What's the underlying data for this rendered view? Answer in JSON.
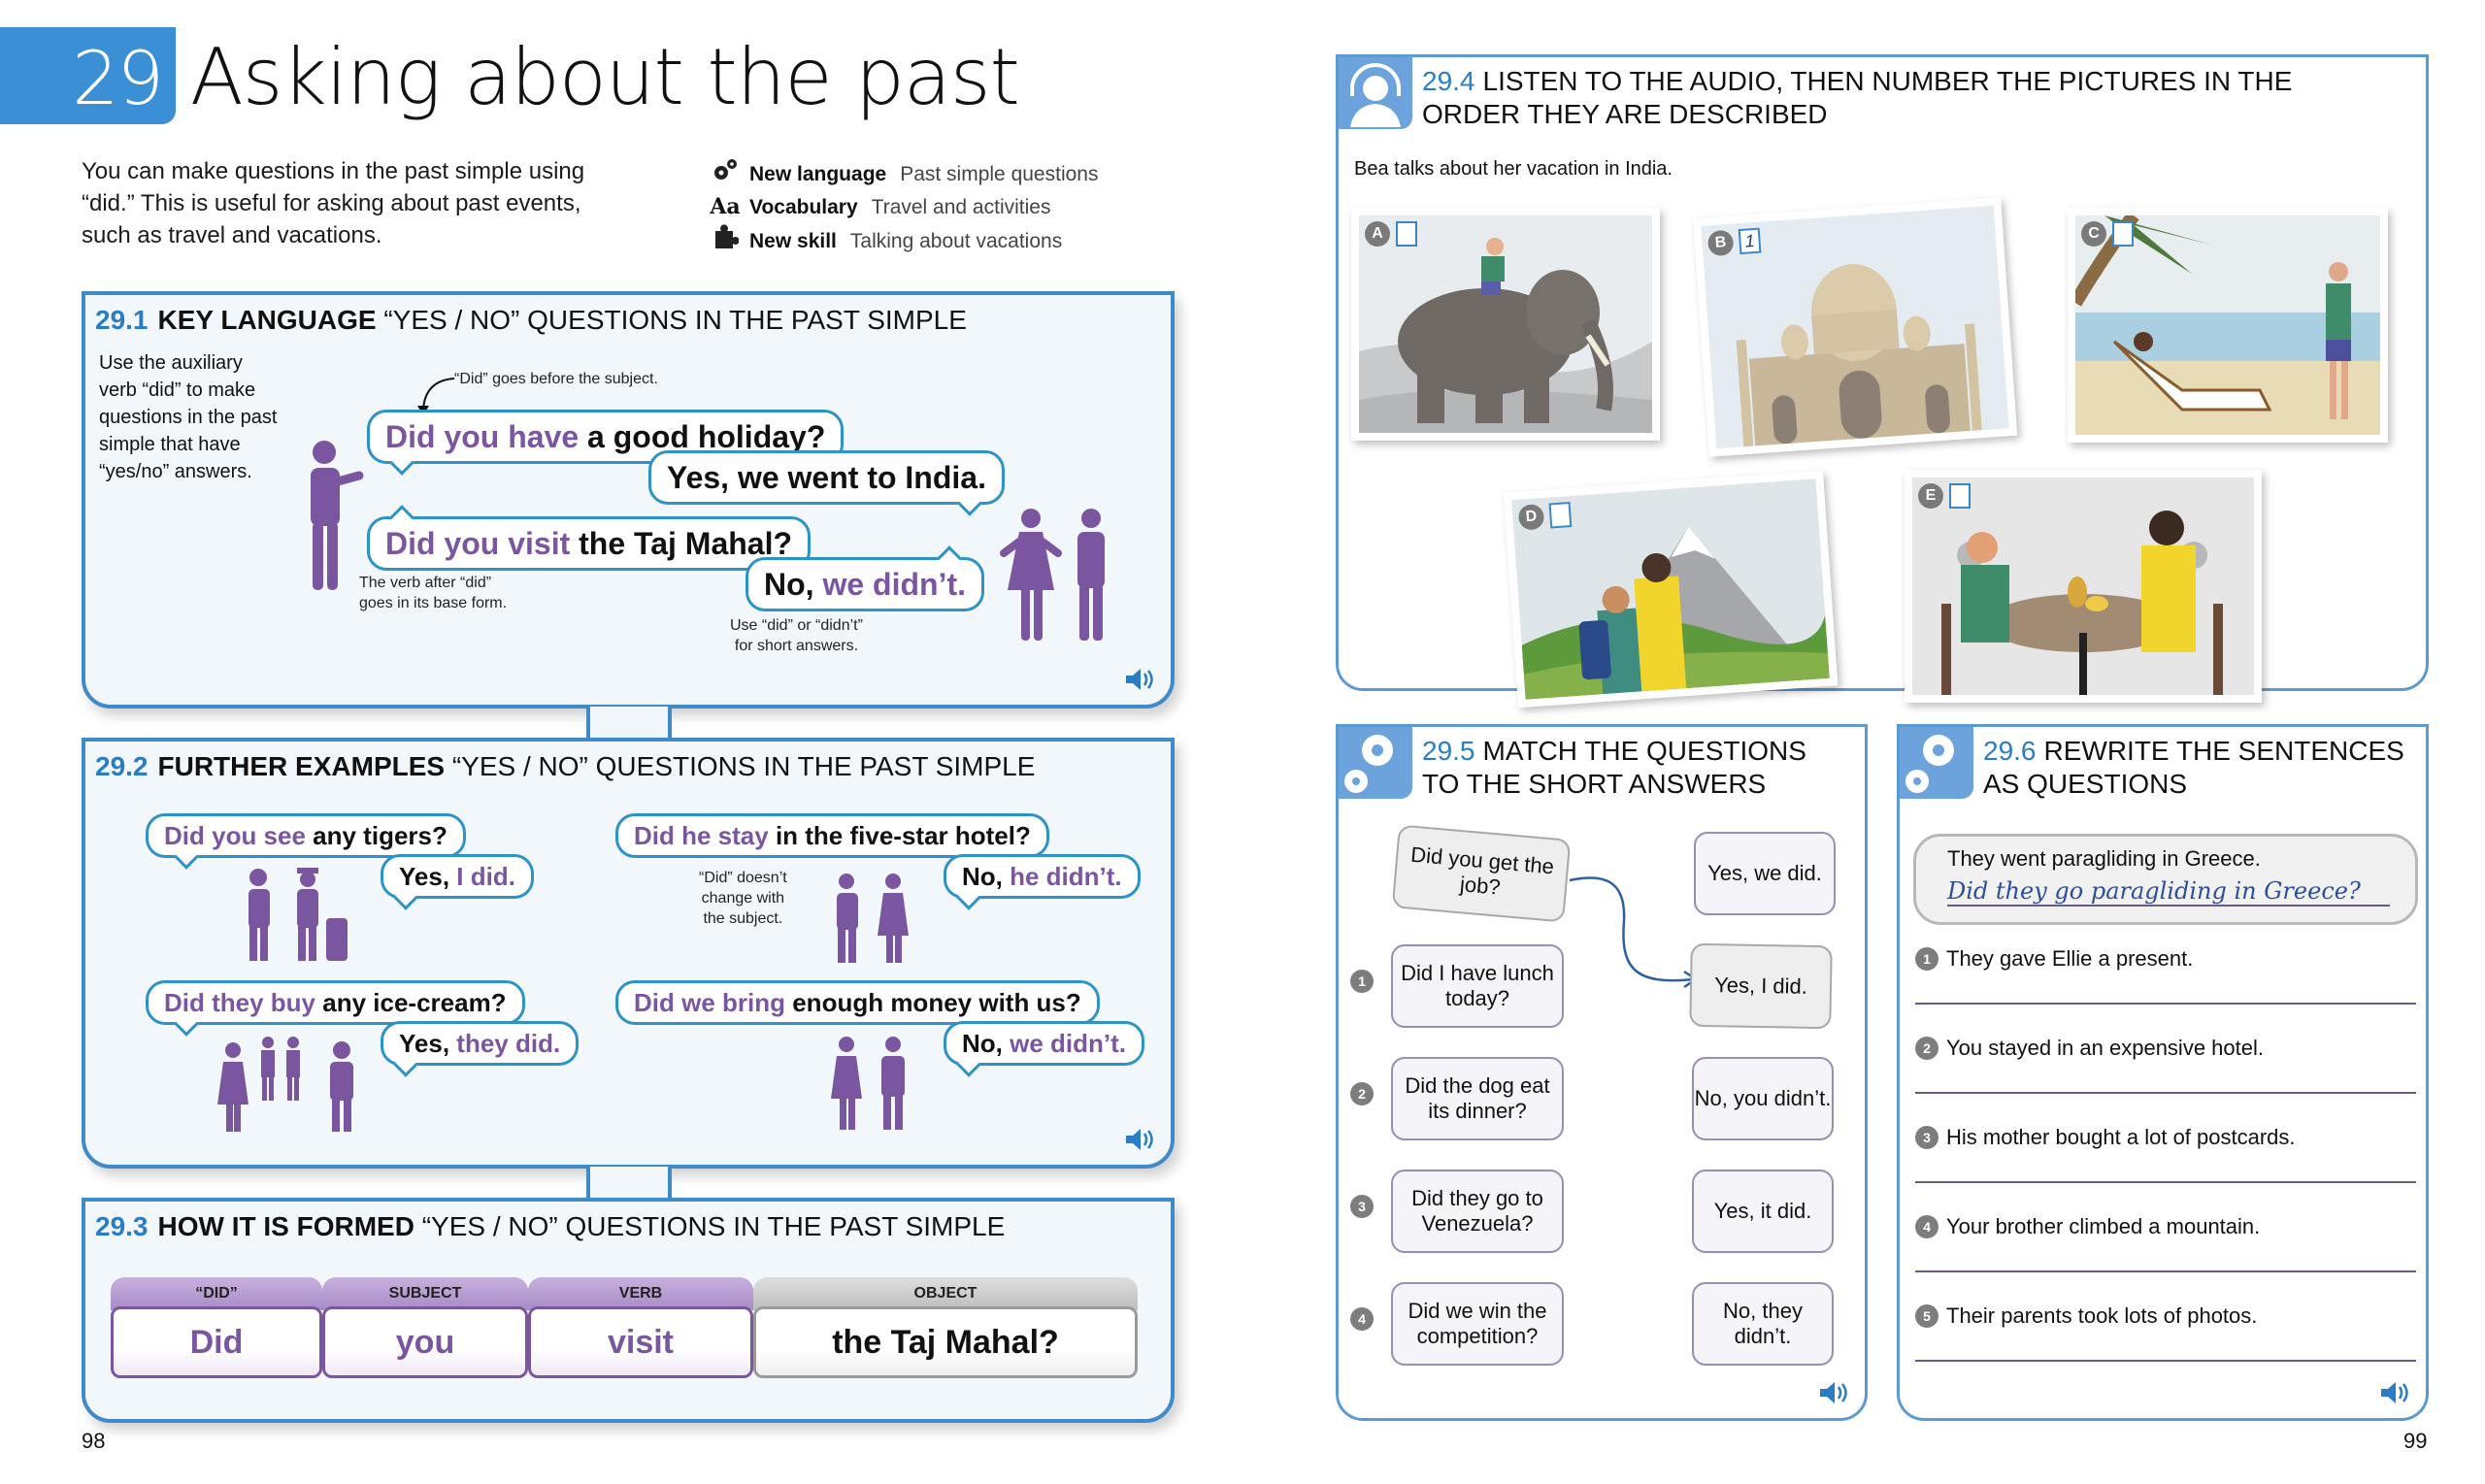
{
  "header": {
    "chapter_number": "29",
    "chapter_title": "Asking about the past",
    "intro_lines": [
      "You can make questions in the past simple using",
      "“did.” This is useful for asking about past events,",
      "such as travel and vacations."
    ],
    "meta": [
      {
        "icon": "gears-icon",
        "key": "New language",
        "value": "Past simple questions"
      },
      {
        "icon": "text-aa-icon",
        "key": "Vocabulary",
        "value": "Travel and activities"
      },
      {
        "icon": "puzzle-icon",
        "key": "New skill",
        "value": "Talking about vacations"
      }
    ]
  },
  "s1": {
    "num": "29.1",
    "key": "KEY LANGUAGE",
    "rest": "“YES / NO” QUESTIONS IN THE PAST SIMPLE",
    "side_lines": [
      "Use the auxiliary",
      "verb “did” to make",
      "questions in the past",
      "simple that have",
      "“yes/no” answers."
    ],
    "note_did_before": "“Did” goes before the subject.",
    "q1_purple": "Did you have",
    "q1_black": " a good holiday?",
    "a1": "Yes, we went to India.",
    "q2_purple": "Did you visit",
    "q2_black": " the Taj Mahal?",
    "a2_black": "No, ",
    "a2_purple": "we didn’t.",
    "note_base_1": "The verb after “did”",
    "note_base_2": "goes in its base form.",
    "note_short_1": "Use “did” or “didn’t”",
    "note_short_2": "for short answers."
  },
  "s2": {
    "num": "29.2",
    "key": "FURTHER EXAMPLES",
    "rest": "“YES / NO” QUESTIONS IN THE PAST SIMPLE",
    "examples": [
      {
        "q_purple": "Did you see",
        "q_black": " any tigers?",
        "a_black": "Yes, ",
        "a_purple": "I did."
      },
      {
        "q_purple": "Did he stay",
        "q_black": " in the five-star hotel?",
        "a_black": "No, ",
        "a_purple": "he didn’t."
      },
      {
        "q_purple": "Did they buy",
        "q_black": " any ice-cream?",
        "a_black": "Yes, ",
        "a_purple": "they did."
      },
      {
        "q_purple": "Did we bring",
        "q_black": " enough money with us?",
        "a_black": "No, ",
        "a_purple": "we didn’t."
      }
    ],
    "note_1": "“Did” doesn’t",
    "note_2": "change with",
    "note_3": "the subject."
  },
  "s3": {
    "num": "29.3",
    "key": "HOW IT IS FORMED",
    "rest": "“YES / NO” QUESTIONS IN THE PAST SIMPLE",
    "pieces": [
      {
        "label": "“DID”",
        "word": "Did"
      },
      {
        "label": "SUBJECT",
        "word": "you"
      },
      {
        "label": "VERB",
        "word": "visit"
      },
      {
        "label": "OBJECT",
        "word": "the Taj Mahal?"
      }
    ]
  },
  "s4": {
    "num": "29.4",
    "title_1": "LISTEN TO THE AUDIO, THEN NUMBER THE PICTURES IN THE",
    "title_2": "ORDER THEY ARE DESCRIBED",
    "instruction": "Bea talks about her vacation in India.",
    "pictures": [
      {
        "letter": "A",
        "answer": "",
        "scene": "elephant ride"
      },
      {
        "letter": "B",
        "answer": "1",
        "scene": "Taj Mahal"
      },
      {
        "letter": "C",
        "answer": "",
        "scene": "beach"
      },
      {
        "letter": "D",
        "answer": "",
        "scene": "mountain hikers"
      },
      {
        "letter": "E",
        "answer": "",
        "scene": "restaurant meal"
      }
    ]
  },
  "s5": {
    "num": "29.5",
    "title_1": "MATCH THE QUESTIONS",
    "title_2": "TO THE SHORT ANSWERS",
    "example_q": "Did you get the job?",
    "questions": [
      {
        "n": "1",
        "text": "Did I have lunch today?"
      },
      {
        "n": "2",
        "text": "Did the dog eat its dinner?"
      },
      {
        "n": "3",
        "text": "Did they go to Venezuela?"
      },
      {
        "n": "4",
        "text": "Did we win the competition?"
      }
    ],
    "answers": [
      "Yes, we did.",
      "Yes, I did.",
      "No, you didn’t.",
      "Yes, it did.",
      "No, they didn’t."
    ]
  },
  "s6": {
    "num": "29.6",
    "title_1": "REWRITE THE SENTENCES",
    "title_2": "AS QUESTIONS",
    "example_sentence": "They went paragliding in Greece.",
    "example_answer": "Did they go paragliding in Greece?",
    "items": [
      {
        "n": "1",
        "text": "They gave Ellie a present.",
        "answer": ""
      },
      {
        "n": "2",
        "text": "You stayed in an expensive hotel.",
        "answer": ""
      },
      {
        "n": "3",
        "text": "His mother bought a lot of postcards.",
        "answer": ""
      },
      {
        "n": "4",
        "text": "Your brother climbed a mountain.",
        "answer": ""
      },
      {
        "n": "5",
        "text": "Their parents took lots of photos.",
        "answer": ""
      }
    ]
  },
  "pages": {
    "left": "98",
    "right": "99"
  },
  "colors": {
    "accent_blue": "#3b8fd4",
    "purple": "#7b56a0",
    "bubble_border": "#2d93c7"
  }
}
